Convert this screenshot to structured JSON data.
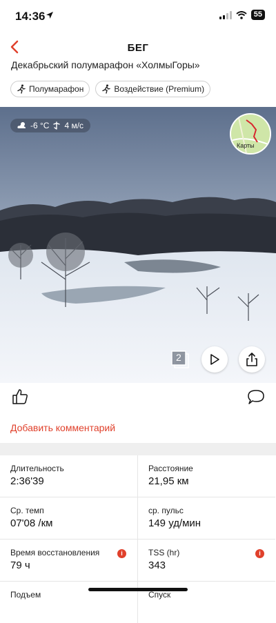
{
  "status_bar": {
    "time": "14:36",
    "battery": "55"
  },
  "header": {
    "title": "БЕГ"
  },
  "activity": {
    "name": "Декабрьский полумарафон «ХолмыГоры»"
  },
  "tags": [
    {
      "label": "Полумарафон",
      "icon": "runner-icon"
    },
    {
      "label": "Воздействие (Premium)",
      "icon": "runner-icon"
    }
  ],
  "weather": {
    "temperature": "-6 °C",
    "wind": "4 м/с"
  },
  "map": {
    "label": "Карты"
  },
  "photo": {
    "count": "2"
  },
  "comment": {
    "add_label": "Добавить комментарий"
  },
  "stats": [
    {
      "label": "Длительность",
      "value": "2:36'39",
      "info": false
    },
    {
      "label": "Расстояние",
      "value": "21,95 км",
      "info": false
    },
    {
      "label": "Ср. темп",
      "value": "07'08 /км",
      "info": false
    },
    {
      "label": "ср. пульс",
      "value": "149 уд/мин",
      "info": false
    },
    {
      "label": "Время восстановления",
      "value": "79 ч",
      "info": true
    },
    {
      "label": "TSS (hr)",
      "value": "343",
      "info": true
    },
    {
      "label": "Подъем",
      "value": "",
      "info": false
    },
    {
      "label": "Спуск",
      "value": "",
      "info": false
    }
  ],
  "colors": {
    "accent": "#e0402b"
  }
}
